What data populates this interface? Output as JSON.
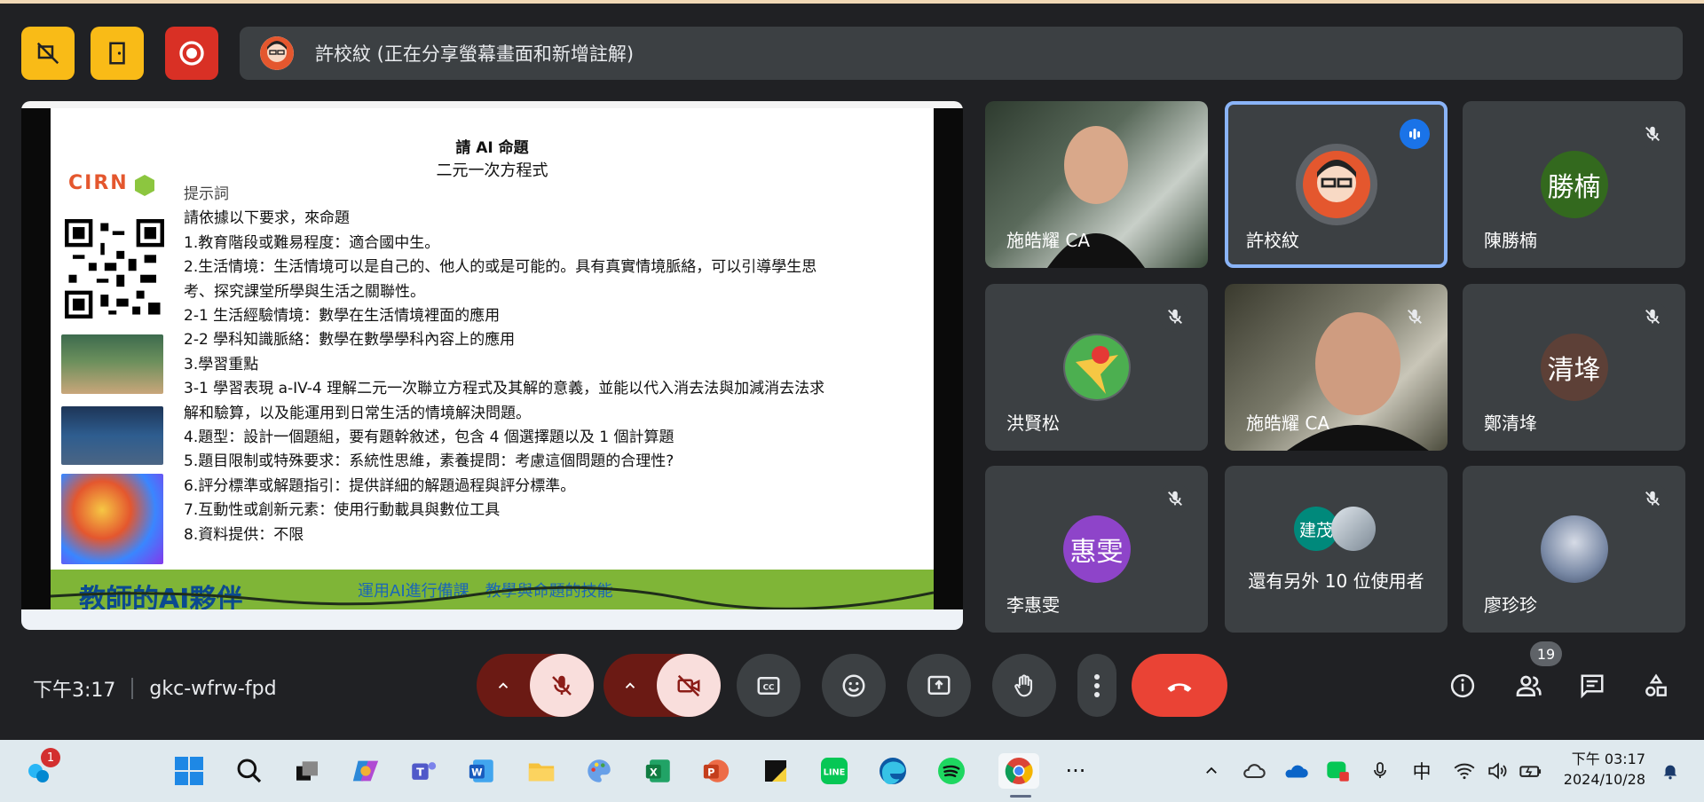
{
  "presenter": {
    "banner": "許校紋 (正在分享螢幕畫面和新增註解)"
  },
  "slide": {
    "title": "請 AI 命題",
    "subtitle": "二元一次方程式",
    "logo_text": "CIRN",
    "hint": "提示詞",
    "lines": [
      "請依據以下要求，來命題",
      "1.教育階段或難易程度：適合國中生。",
      "2.生活情境：生活情境可以是自己的、他人的或是可能的。具有真實情境脈絡，可以引導學生思",
      "考、探究課堂所學與生活之關聯性。",
      "2-1 生活經驗情境：數學在生活情境裡面的應用",
      "2-2 學科知識脈絡：數學在數學學科內容上的應用",
      "3.學習重點",
      "3-1 學習表現 a-IV-4 理解二元一次聯立方程式及其解的意義，並能以代入消去法與加減消去法求",
      "解和驗算，以及能運用到日常生活的情境解決問題。",
      "4.題型：設計一個題組，要有題幹敘述，包含 4 個選擇題以及 1 個計算題",
      "5.題目限制或特殊要求：系統性思維，素養提問：考慮這個問題的合理性?",
      "6.評分標準或解題指引：提供詳細的解題過程與評分標準。",
      "7.互動性或創新元素：使用行動載具與數位工具",
      "8.資料提供：不限"
    ],
    "banner_big": "教師的AI夥伴",
    "banner_small": "運用AI進行備課　教學與命題的技能"
  },
  "participants": [
    {
      "name": "施皓耀 CA",
      "type": "video"
    },
    {
      "name": "許校紋",
      "type": "avatar",
      "speaking": true
    },
    {
      "name": "陳勝楠",
      "type": "initials",
      "initials": "勝楠",
      "color": "#33691e",
      "muted": true
    },
    {
      "name": "洪賢松",
      "type": "logo",
      "muted": true
    },
    {
      "name": "施皓耀 CA",
      "type": "video",
      "muted": true
    },
    {
      "name": "鄭清埄",
      "type": "initials",
      "initials": "清埄",
      "color": "#5d4037",
      "muted": true
    },
    {
      "name": "李惠雯",
      "type": "initials",
      "initials": "惠雯",
      "color": "#8e44c9",
      "muted": true
    },
    {
      "name": "還有另外 10 位使用者",
      "type": "others",
      "initials": "建茂"
    },
    {
      "name": "廖珍珍",
      "type": "photo",
      "muted": true
    }
  ],
  "meeting": {
    "time": "下午3:17",
    "code": "gkc-wfrw-fpd",
    "participant_count": "19"
  },
  "taskbar": {
    "notification_count": "1",
    "ime": "中",
    "clock_time": "下午 03:17",
    "clock_date": "2024/10/28"
  },
  "colors": {
    "end_call": "#ea4335",
    "active_border": "#8ab4f8",
    "toolbar_bg": "#3c4043"
  }
}
